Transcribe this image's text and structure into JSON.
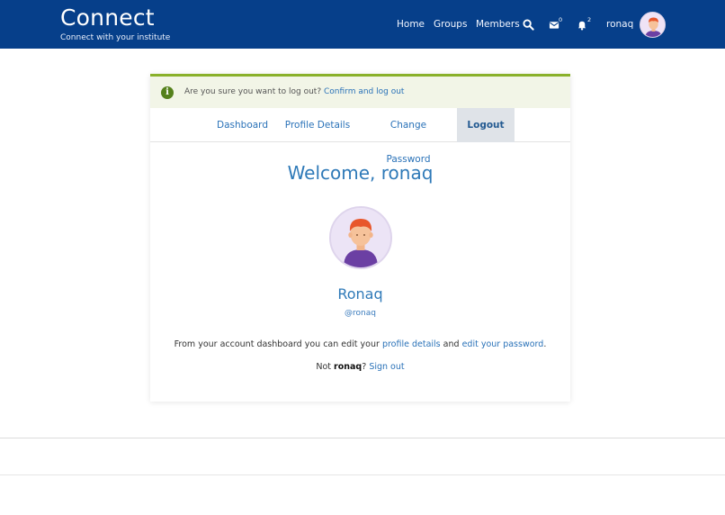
{
  "header": {
    "brand_title": "Connect",
    "brand_tagline": "Connect with your institute",
    "nav": {
      "home": "Home",
      "groups": "Groups",
      "members": "Members",
      "messages_count": "0",
      "notifications_count": "2",
      "username": "ronaq"
    },
    "icons": {
      "search": "search-icon",
      "messages": "envelope-icon",
      "notifications": "bell-icon",
      "avatar": "user-avatar"
    }
  },
  "alert": {
    "text": "Are you sure you want to log out?",
    "link": "Confirm and log out",
    "icon": "info-icon"
  },
  "tabs": [
    {
      "label": "Dashboard",
      "active": false
    },
    {
      "label": "Profile Details",
      "active": false
    },
    {
      "label": "Change Password",
      "active": false
    },
    {
      "label": "Logout",
      "active": true
    }
  ],
  "main": {
    "welcome": "Welcome, ronaq",
    "profile_name": "Ronaq",
    "profile_handle": "@ronaq",
    "dash_text_before": "From your account dashboard you can edit your",
    "dash_link_profile": "profile details",
    "dash_text_and": "and",
    "dash_link_password": "edit your password",
    "dash_text_after": ".",
    "not_text": "Not",
    "not_user": "ronaq",
    "not_q": "?",
    "signout_link": "Sign out"
  },
  "colors": {
    "header_bg": "#063f8a",
    "accent_blue": "#2a72b8",
    "alert_border": "#8ab12b",
    "alert_bg": "#f2f5e7",
    "active_tab_bg": "#dfe3e8"
  }
}
